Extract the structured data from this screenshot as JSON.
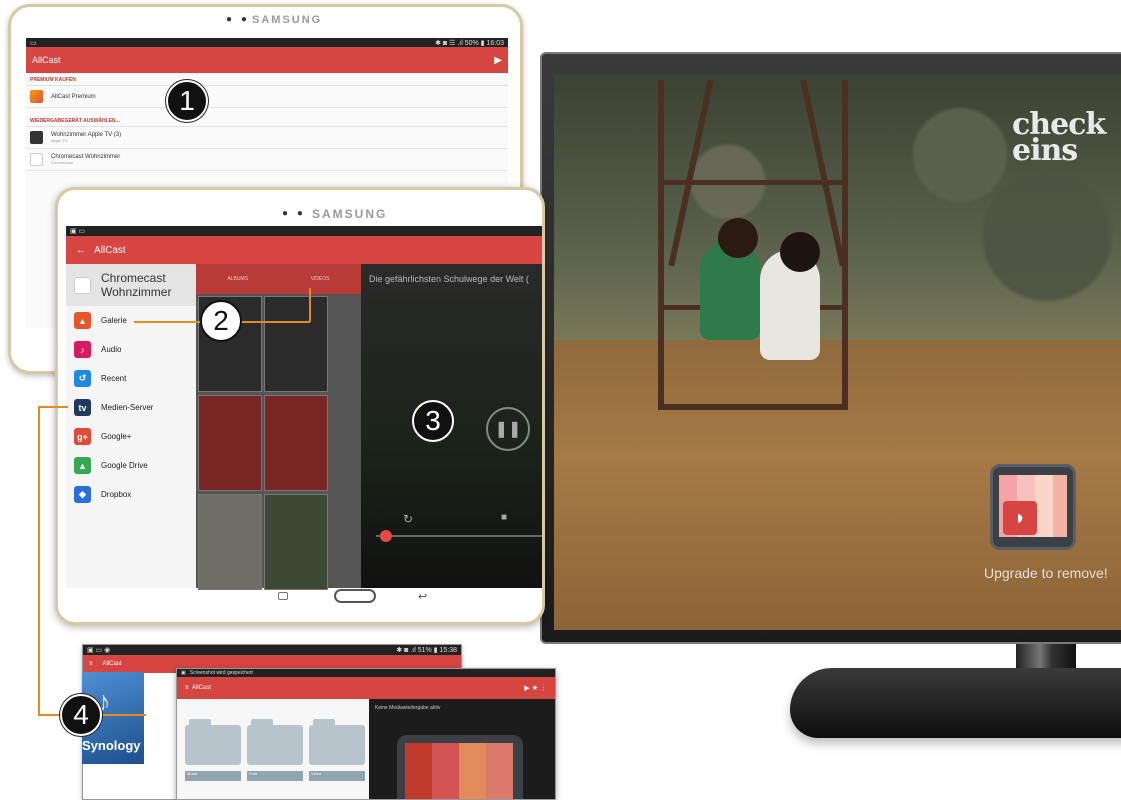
{
  "tablet_brand": "SAMSUNG",
  "screen1": {
    "app_title": "AllCast",
    "status_right": "✱ ◙ ☰ .ıl 50% ▮ 16:03",
    "section_premium": "PREMIUM KAUFEN",
    "premium_item": "AllCast Premium",
    "section_devices": "WIEDERGABEGERÄT AUSWÄHLEN...",
    "device1_name": "Wohnzimmer Apple TV (3)",
    "device1_sub": "Apple TV",
    "device2_name": "Chromecast Wohnzimmer",
    "device2_sub": "Chromecast"
  },
  "screen2": {
    "app_title": "AllCast",
    "back_arrow": "←",
    "device_header": "Chromecast Wohnzimmer",
    "tabs": [
      "ALBUMS",
      "VIDEOS"
    ],
    "video_title": "Die gefährlichsten Schulwege der Welt (",
    "drawer_items": [
      {
        "label": "Galerie",
        "color": "#e9552b",
        "glyph": "▲"
      },
      {
        "label": "Audio",
        "color": "#d81b60",
        "glyph": "♪"
      },
      {
        "label": "Recent",
        "color": "#1e88e5",
        "glyph": "↺"
      },
      {
        "label": "Medien-Server",
        "color": "#1f3a5f",
        "glyph": "tv"
      },
      {
        "label": "Google+",
        "color": "#dd4b39",
        "glyph": "g+"
      },
      {
        "label": "Google Drive",
        "color": "#34a853",
        "glyph": "▲"
      },
      {
        "label": "Dropbox",
        "color": "#2a6fdb",
        "glyph": "◆"
      }
    ]
  },
  "screen3": {
    "app_title": "AllCast",
    "notification": "Screenshot wird gespeichert",
    "player_status": "Keine Mediawiedergabe aktiv",
    "synology_label": "Synology",
    "folders": [
      "Musik",
      "Foto",
      "Video"
    ]
  },
  "tv": {
    "logo_line1": "check",
    "logo_line2": "eins",
    "upgrade_text": "Upgrade to remove!"
  },
  "callouts": [
    "1",
    "2",
    "3",
    "4"
  ],
  "colors": {
    "accent_red": "#d64541",
    "callout_line": "#e58a1f"
  }
}
